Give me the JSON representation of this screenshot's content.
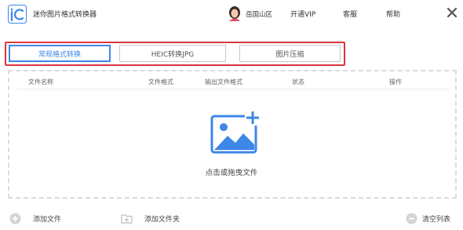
{
  "titlebar": {
    "app_title": "迷你图片格式转换器",
    "username": "岳国山区",
    "vip_label": "开通VIP",
    "service_label": "客服",
    "help_label": "帮助"
  },
  "tabs": [
    {
      "label": "常规格式转换",
      "active": true
    },
    {
      "label": "HEIC转换JPG",
      "active": false
    },
    {
      "label": "图片压缩",
      "active": false
    }
  ],
  "table": {
    "columns": [
      "文件名称",
      "文件格式",
      "输出文件格式",
      "状态",
      "操作"
    ]
  },
  "dropzone": {
    "text": "点击或拖曳文件"
  },
  "bottom": {
    "add_file_label": "添加文件",
    "add_folder_label": "添加文件夹",
    "clear_list_label": "清空列表"
  },
  "colors": {
    "accent": "#3d87e8",
    "highlight_frame": "#d9363e",
    "icon_gray": "#cfcfcf"
  },
  "icons": {
    "logo": "app-logo-icon",
    "close": "close-icon",
    "upload": "add-image-icon",
    "add_file": "plus-circle-icon",
    "add_folder": "folder-plus-icon",
    "clear_list": "clear-circle-icon"
  }
}
